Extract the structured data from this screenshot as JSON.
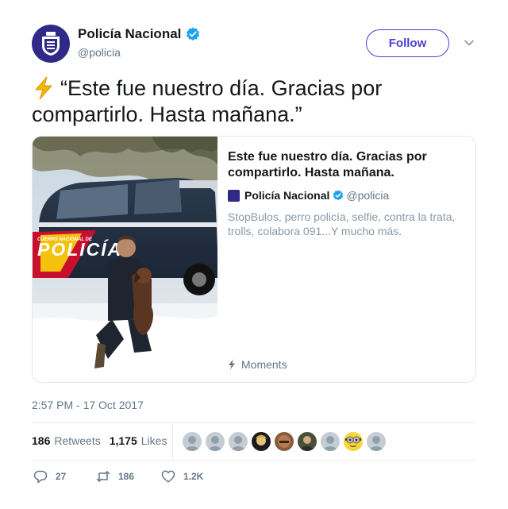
{
  "author": {
    "name": "Policía Nacional",
    "handle": "@policia",
    "avatar_icon": "police-emblem-icon",
    "verified": true
  },
  "follow_label": "Follow",
  "tweet": {
    "emoji": "lightning-bolt-icon",
    "text": "“Este fue nuestro día. Gracias por compartirlo. Hasta mañana.”"
  },
  "card": {
    "image_vehicle_text": "POLICÍA",
    "image_vehicle_small_text": "CUERPO NACIONAL DE",
    "title": "Este fue nuestro día. Gracias por compartirlo. Hasta mañana.",
    "author_name": "Policía Nacional",
    "author_handle": "@policia",
    "description": "StopBulos, perro policía, selfie, contra la trata, trolls, colabora 091...Y mucho más.",
    "moments_label": "Moments"
  },
  "timestamp": "2:57 PM - 17 Oct 2017",
  "stats": {
    "retweets_count": "186",
    "retweets_label": "Retweets",
    "likes_count": "1,175",
    "likes_label": "Likes"
  },
  "actions": {
    "reply_count": "27",
    "retweet_count": "186",
    "like_count": "1.2K"
  },
  "colors": {
    "accent": "#4a3fd1",
    "verified": "#1da1f2",
    "muted": "#657786"
  }
}
